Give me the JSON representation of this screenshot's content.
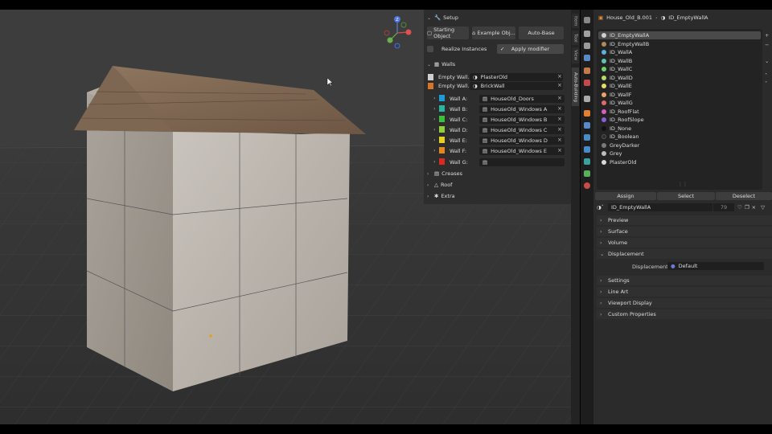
{
  "navigation_gizmo": {
    "z_label": "Z"
  },
  "npanel": {
    "setup_header": "Setup",
    "starting_object": "Starting Object",
    "example_obj": "Example Obj...",
    "auto_base": "Auto-Base",
    "realize_instances": "Realize Instances",
    "apply_modifier": "Apply modifier",
    "walls_header": "Walls",
    "empty_wall_1_label": "Empty Wall...",
    "empty_wall_1_value": "PlasterOld",
    "empty_wall_2_label": "Empty Wall...",
    "empty_wall_2_value": "BrickWall",
    "wall_rows": [
      {
        "label": "Wall A:",
        "value": "HouseOld_Doors",
        "color": "#1f9bd6"
      },
      {
        "label": "Wall B:",
        "value": "HouseOld_Windows A",
        "color": "#2bb5a0"
      },
      {
        "label": "Wall C:",
        "value": "HouseOld_Windows B",
        "color": "#3cc03c"
      },
      {
        "label": "Wall D:",
        "value": "HouseOld_Windows C",
        "color": "#8fd13a"
      },
      {
        "label": "Wall E:",
        "value": "HouseOld_Windows D",
        "color": "#e6d020"
      },
      {
        "label": "Wall F:",
        "value": "HouseOld_Windows E",
        "color": "#e6861f"
      },
      {
        "label": "Wall G:",
        "value": "",
        "color": "#d92a1f"
      }
    ],
    "creases_header": "Creases",
    "roof_header": "Roof",
    "extra_header": "Extra"
  },
  "tabs": {
    "item": "Item",
    "tool": "Tool",
    "view": "View",
    "auto_building": "Auto-Building"
  },
  "properties": {
    "breadcrumb_object": "House_Old_B.001",
    "breadcrumb_material": "ID_EmptyWallA",
    "slots": [
      {
        "name": "ID_EmptyWallA",
        "color": "#cfcfcf",
        "active": true
      },
      {
        "name": "ID_EmptyWallB",
        "color": "#b08a5a"
      },
      {
        "name": "ID_WallA",
        "color": "#5bb0e0"
      },
      {
        "name": "ID_WallB",
        "color": "#5cc4b0"
      },
      {
        "name": "ID_WallC",
        "color": "#6fd06f"
      },
      {
        "name": "ID_WallD",
        "color": "#b5d96a"
      },
      {
        "name": "ID_WallE",
        "color": "#eadc6a"
      },
      {
        "name": "ID_WallF",
        "color": "#eaa36a"
      },
      {
        "name": "ID_WallG",
        "color": "#e06a6a"
      },
      {
        "name": "ID_RoofFlat",
        "color": "#d45fc0"
      },
      {
        "name": "ID_RoofSlope",
        "color": "#8c5fd4"
      },
      {
        "name": "ID_None",
        "color": "#111111"
      },
      {
        "name": "ID_Boolean",
        "color": "#2b2b2b"
      },
      {
        "name": "GreyDarker",
        "color": "#7a7a7a"
      },
      {
        "name": "Grey",
        "color": "#bdbdbd"
      },
      {
        "name": "PlasterOld",
        "color": "#d8d8d8"
      }
    ],
    "assign": "Assign",
    "select": "Select",
    "deselect": "Deselect",
    "material_name": "ID_EmptyWallA",
    "user_count": "79",
    "sections": {
      "preview": "Preview",
      "surface": "Surface",
      "volume": "Volume",
      "displacement": "Displacement",
      "displacement_label": "Displacement",
      "displacement_value": "Default",
      "settings": "Settings",
      "line_art": "Line Art",
      "viewport_display": "Viewport Display",
      "custom_properties": "Custom Properties"
    }
  }
}
